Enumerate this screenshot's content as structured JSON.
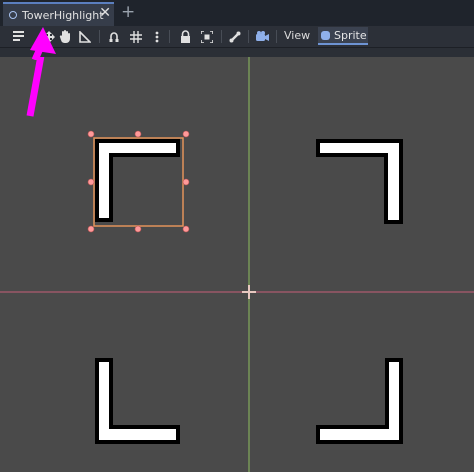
{
  "tab": {
    "title": "TowerHighlight",
    "close_glyph": "✕",
    "new_tab_glyph": "+"
  },
  "toolbar": {
    "view_label": "View",
    "sprite_label": "Sprite",
    "tools": [
      "select-list-icon",
      "move-icon",
      "pan-icon",
      "ruler-icon",
      "snap-icon",
      "grid-icon",
      "more-icon",
      "lock-icon",
      "group-icon",
      "bone-icon",
      "camera-icon"
    ]
  },
  "colors": {
    "accent": "#5b7fbf",
    "selection": "#e2935b",
    "handle": "#ff8c8c",
    "annotation_arrow": "#ff00ff",
    "axis_x": "#e06a86",
    "axis_y": "#9ed06b"
  }
}
